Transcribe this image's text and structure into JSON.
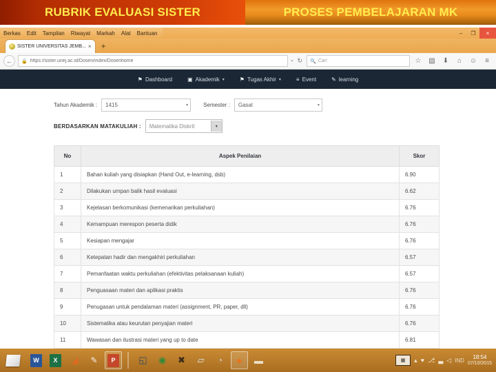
{
  "slide": {
    "banner_left": "RUBRIK EVALUASI SISTER",
    "banner_right": "PROSES PEMBELAJARAN MK"
  },
  "browser": {
    "menu": [
      {
        "label": "Berkas"
      },
      {
        "label": "Edit"
      },
      {
        "label": "Tampilan"
      },
      {
        "label": "Riwayat"
      },
      {
        "label": "Markah"
      },
      {
        "label": "Alat"
      },
      {
        "label": "Bantuan"
      }
    ],
    "window_controls": {
      "minimize": "–",
      "maximize": "❐",
      "close": "×"
    },
    "tab": {
      "title": "SISTER UNIVERSITAS JEMB...",
      "close": "×",
      "new_tab": "+"
    },
    "nav": {
      "back": "←",
      "lock": "ὑ2",
      "url": "https://sister.unej.ac.id/Dosen/index/Dosenhome",
      "url_caret": "▾",
      "reload": "↻"
    },
    "search": {
      "icon": "⚲",
      "placeholder": "Cari"
    },
    "toolbar_icons": [
      {
        "name": "bookmark-star-icon",
        "glyph": "☆"
      },
      {
        "name": "reader-view-icon",
        "glyph": "▧"
      },
      {
        "name": "downloads-icon",
        "glyph": "⬇"
      },
      {
        "name": "home-icon",
        "glyph": "⌂"
      },
      {
        "name": "account-icon",
        "glyph": "☺"
      },
      {
        "name": "menu-hamburger-icon",
        "glyph": "≡"
      }
    ]
  },
  "site": {
    "nav_items": [
      {
        "label": "Dashboard",
        "icon": "⚑",
        "caret": ""
      },
      {
        "label": "Akademik",
        "icon": "▣",
        "caret": "▾"
      },
      {
        "label": "Tugas Akhir",
        "icon": "⚑",
        "caret": "▾"
      },
      {
        "label": "Event",
        "icon": "≡",
        "caret": ""
      },
      {
        "label": "learning",
        "icon": "✎",
        "caret": ""
      }
    ],
    "filters": {
      "tahun_label": "Tahun Akademik :",
      "tahun_value": "1415",
      "semester_label": "Semester :",
      "semester_value": "Gasal",
      "matakuliah_label": "BERDASARKAN MATAKULIAH :",
      "matakuliah_value": "Matematika Diskrit",
      "arrow": "▾"
    },
    "table": {
      "headers": [
        "No",
        "Aspek Penilaian",
        "Skor"
      ],
      "rows": [
        {
          "no": "1",
          "aspek": "Bahan kuliah yang disiapkan (Hand Out, e-learning, dsb)",
          "skor": "6.90"
        },
        {
          "no": "2",
          "aspek": "Dilakukan umpan balik hasil evaluasi",
          "skor": "6.62"
        },
        {
          "no": "3",
          "aspek": "Kejelasan berkomunikasi (kemenarikan perkuliahan)",
          "skor": "6.76"
        },
        {
          "no": "4",
          "aspek": "Kemampuan merespon peserta didik",
          "skor": "6.76"
        },
        {
          "no": "5",
          "aspek": "Kesiapan mengajar",
          "skor": "6.76"
        },
        {
          "no": "6",
          "aspek": "Ketepatan hadir dan mengakhiri perkuliahan",
          "skor": "6.57"
        },
        {
          "no": "7",
          "aspek": "Pemanfaatan waktu perkuliahan (efektivitas pelaksanaan kuliah)",
          "skor": "6.57"
        },
        {
          "no": "8",
          "aspek": "Penguasaan materi dan aplikasi praktis",
          "skor": "6.76"
        },
        {
          "no": "9",
          "aspek": "Penugasan untuk pendalaman materi (assignment, PR, paper, dll)",
          "skor": "6.76"
        },
        {
          "no": "10",
          "aspek": "Sistematika atau keurutan penyajian materi",
          "skor": "6.76"
        },
        {
          "no": "11",
          "aspek": "Wawasan dan ilustrasi materi yang up to date",
          "skor": "6.81"
        }
      ]
    }
  },
  "taskbar": {
    "start": "start-button",
    "apps": [
      {
        "name": "word-icon",
        "glyph": "W"
      },
      {
        "name": "excel-icon",
        "glyph": "X"
      },
      {
        "name": "matlab-icon",
        "glyph": "◢"
      },
      {
        "name": "paint-icon",
        "glyph": "✎"
      },
      {
        "name": "powerpoint-icon",
        "glyph": "P"
      },
      {
        "name": "explorer-icon",
        "glyph": "◱"
      },
      {
        "name": "endnote-icon",
        "glyph": "◉"
      },
      {
        "name": "xmind-icon",
        "glyph": "✖"
      },
      {
        "name": "notepad-icon",
        "glyph": "▱"
      },
      {
        "name": "media-icon",
        "glyph": "◔"
      },
      {
        "name": "firefox-icon",
        "glyph": "●"
      },
      {
        "name": "folder-icon",
        "glyph": "▬"
      }
    ],
    "tray": {
      "show_desktop": "▦",
      "expand": "▴",
      "security_icon": "♥",
      "network_icon": "⎇",
      "signal_icon": "▃",
      "volume_icon": "◁",
      "language": "IND",
      "time": "18:54",
      "date": "07/10/2015"
    }
  }
}
